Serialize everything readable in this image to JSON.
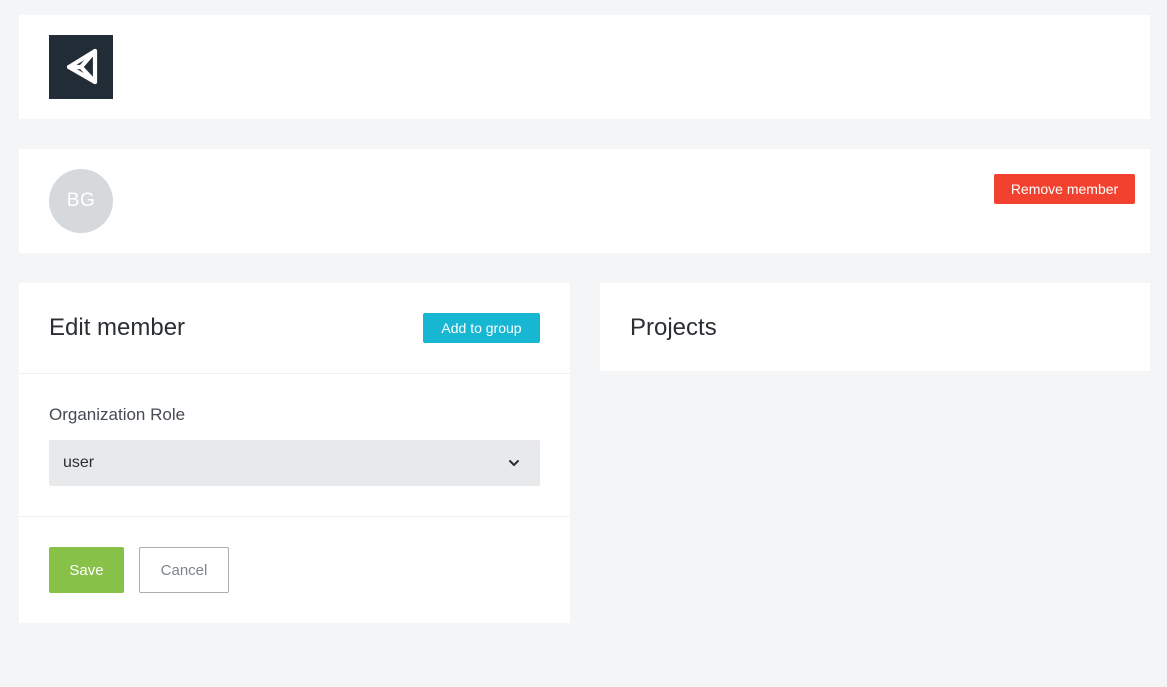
{
  "header": {
    "logo_icon": "unity-logo-icon"
  },
  "member": {
    "initials": "BG",
    "remove_label": "Remove member",
    "remove_color": "#f2412f"
  },
  "edit": {
    "title": "Edit member",
    "add_to_group_label": "Add to group",
    "role_label": "Organization Role",
    "role_value": "user",
    "save_label": "Save",
    "cancel_label": "Cancel",
    "save_color": "#88c148",
    "accent_color": "#17b6d3"
  },
  "projects": {
    "title": "Projects"
  }
}
